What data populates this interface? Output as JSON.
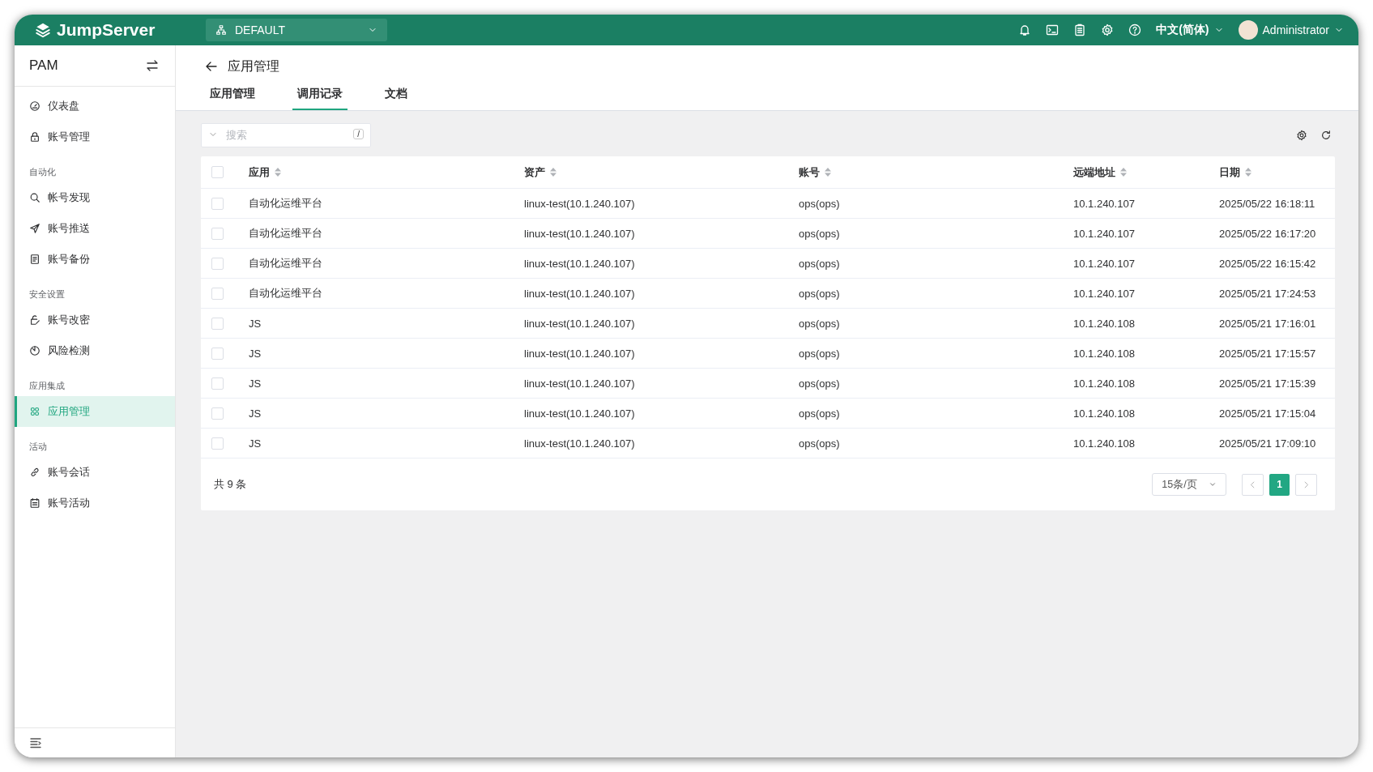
{
  "header": {
    "brand": "JumpServer",
    "org": "DEFAULT",
    "language": "中文(简体)",
    "user": "Administrator"
  },
  "sidebar": {
    "title": "PAM",
    "groups": [
      {
        "items": [
          {
            "label": "仪表盘",
            "selected": false
          },
          {
            "label": "账号管理",
            "selected": false
          }
        ]
      },
      {
        "heading": "自动化",
        "items": [
          {
            "label": "帐号发现",
            "selected": false
          },
          {
            "label": "账号推送",
            "selected": false
          },
          {
            "label": "账号备份",
            "selected": false
          }
        ]
      },
      {
        "heading": "安全设置",
        "items": [
          {
            "label": "账号改密",
            "selected": false
          },
          {
            "label": "风险检测",
            "selected": false
          }
        ]
      },
      {
        "heading": "应用集成",
        "items": [
          {
            "label": "应用管理",
            "selected": true
          }
        ]
      },
      {
        "heading": "活动",
        "items": [
          {
            "label": "账号会话",
            "selected": false
          },
          {
            "label": "账号活动",
            "selected": false
          }
        ]
      }
    ]
  },
  "page": {
    "title": "应用管理",
    "tabs": [
      {
        "label": "应用管理",
        "selected": false
      },
      {
        "label": "调用记录",
        "selected": true
      },
      {
        "label": "文档",
        "selected": false
      }
    ]
  },
  "search": {
    "placeholder": "搜索",
    "shortcut": "/"
  },
  "table": {
    "select_all": {
      "checked": false
    },
    "columns": [
      {
        "label": "应用",
        "sortable": true
      },
      {
        "label": "资产",
        "sortable": true
      },
      {
        "label": "账号",
        "sortable": true
      },
      {
        "label": "远端地址",
        "sortable": true
      },
      {
        "label": "日期",
        "sortable": true
      }
    ],
    "rows": [
      {
        "checked": false,
        "cells": [
          "自动化运维平台",
          "linux-test(10.1.240.107)",
          "ops(ops)",
          "10.1.240.107",
          "2025/05/22 16:18:11"
        ]
      },
      {
        "checked": false,
        "cells": [
          "自动化运维平台",
          "linux-test(10.1.240.107)",
          "ops(ops)",
          "10.1.240.107",
          "2025/05/22 16:17:20"
        ]
      },
      {
        "checked": false,
        "cells": [
          "自动化运维平台",
          "linux-test(10.1.240.107)",
          "ops(ops)",
          "10.1.240.107",
          "2025/05/22 16:15:42"
        ]
      },
      {
        "checked": false,
        "cells": [
          "自动化运维平台",
          "linux-test(10.1.240.107)",
          "ops(ops)",
          "10.1.240.107",
          "2025/05/21 17:24:53"
        ]
      },
      {
        "checked": false,
        "cells": [
          "JS",
          "linux-test(10.1.240.107)",
          "ops(ops)",
          "10.1.240.108",
          "2025/05/21 17:16:01"
        ]
      },
      {
        "checked": false,
        "cells": [
          "JS",
          "linux-test(10.1.240.107)",
          "ops(ops)",
          "10.1.240.108",
          "2025/05/21 17:15:57"
        ]
      },
      {
        "checked": false,
        "cells": [
          "JS",
          "linux-test(10.1.240.107)",
          "ops(ops)",
          "10.1.240.108",
          "2025/05/21 17:15:39"
        ]
      },
      {
        "checked": false,
        "cells": [
          "JS",
          "linux-test(10.1.240.107)",
          "ops(ops)",
          "10.1.240.108",
          "2025/05/21 17:15:04"
        ]
      },
      {
        "checked": false,
        "cells": [
          "JS",
          "linux-test(10.1.240.107)",
          "ops(ops)",
          "10.1.240.108",
          "2025/05/21 17:09:10"
        ]
      }
    ]
  },
  "pagination": {
    "total": "共 9 条",
    "page_size": "15条/页",
    "pages": [
      {
        "label": "1",
        "selected": true
      }
    ]
  }
}
